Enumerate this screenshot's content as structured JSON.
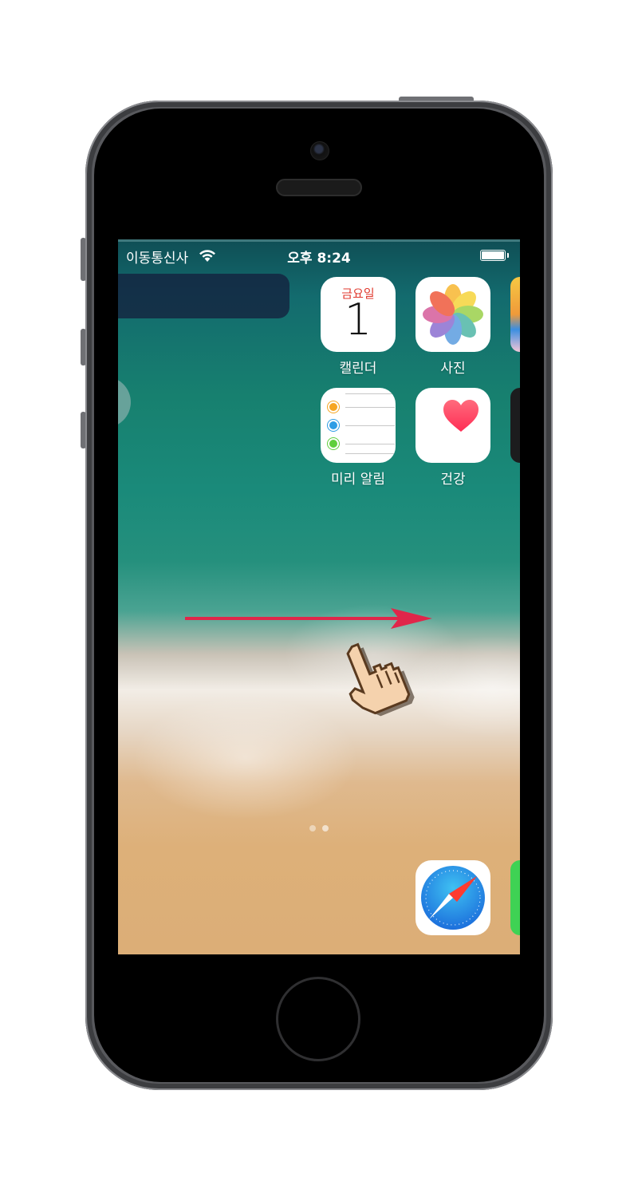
{
  "status_bar": {
    "carrier": "이동통신사",
    "time": "오후 8:24"
  },
  "apps": {
    "calendar": {
      "label": "캘린더",
      "weekday": "금요일",
      "day": "1"
    },
    "photos": {
      "label": "사진"
    },
    "reminders": {
      "label": "미리 알림"
    },
    "health": {
      "label": "건강"
    },
    "safari": {
      "label": ""
    }
  },
  "colors": {
    "accent_arrow": "#e0264a",
    "calendar_red": "#e03a2f"
  },
  "gesture": {
    "direction": "swipe-right",
    "pointer": "hand-cursor-icon"
  }
}
